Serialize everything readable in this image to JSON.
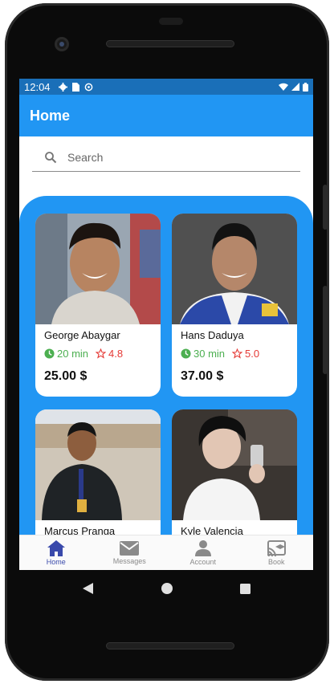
{
  "status_bar": {
    "time": "12:04"
  },
  "app_bar": {
    "title": "Home"
  },
  "search": {
    "placeholder": "Search"
  },
  "colors": {
    "accent": "#2196f3",
    "status": "#1a6fb8",
    "time_green": "#4caf50",
    "rating_red": "#e53935",
    "nav_active": "#3949ab"
  },
  "cards": [
    {
      "name": "George Abaygar",
      "time": "20 min",
      "rating": "4.8",
      "price": "25.00 $"
    },
    {
      "name": "Hans Daduya",
      "time": "30 min",
      "rating": "5.0",
      "price": "37.00 $"
    },
    {
      "name": "Marcus Pranga"
    },
    {
      "name": "Kyle Valencia"
    }
  ],
  "bottom_nav": [
    {
      "label": "Home",
      "icon": "home-icon",
      "active": true
    },
    {
      "label": "Messages",
      "icon": "mail-icon"
    },
    {
      "label": "Account",
      "icon": "person-icon"
    },
    {
      "label": "Book",
      "icon": "cast-icon"
    }
  ]
}
